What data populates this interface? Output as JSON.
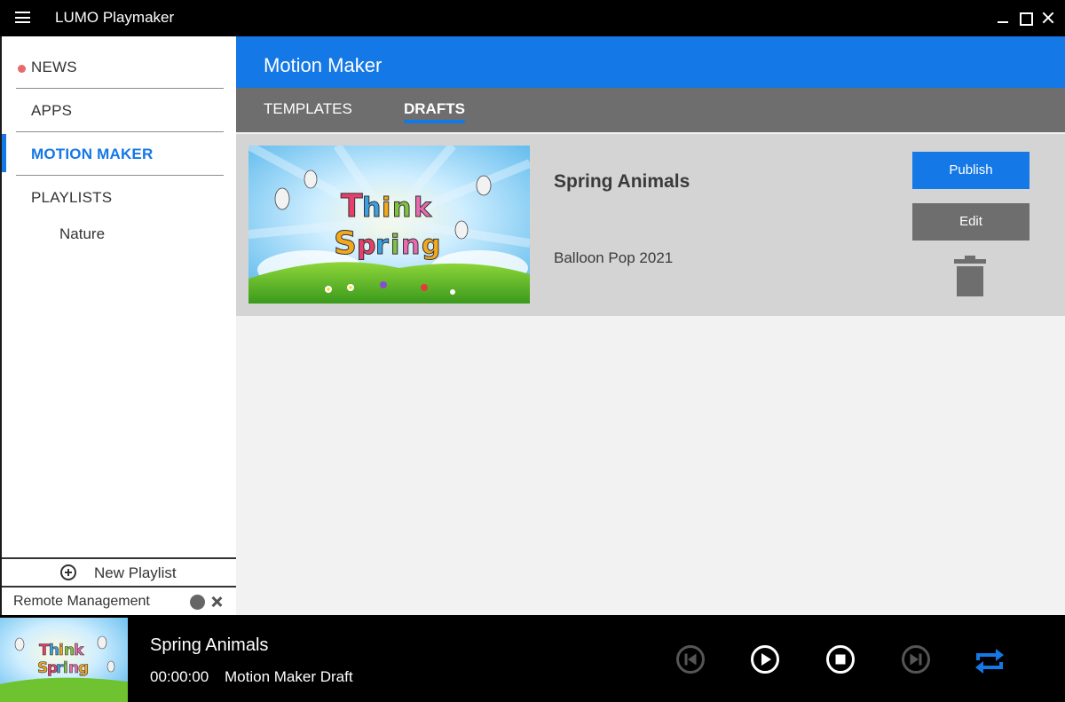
{
  "window": {
    "title": "LUMO Playmaker"
  },
  "sidebar": {
    "items": [
      {
        "label": "NEWS",
        "badge_color": "#e86a6a"
      },
      {
        "label": "APPS"
      },
      {
        "label": "MOTION MAKER",
        "active": true
      },
      {
        "label": "PLAYLISTS"
      }
    ],
    "playlists": [
      {
        "label": "Nature"
      }
    ],
    "new_playlist_label": "New Playlist",
    "remote_management_label": "Remote Management",
    "remote_management_enabled": false
  },
  "main": {
    "title": "Motion Maker",
    "tabs": [
      {
        "label": "TEMPLATES",
        "active": false
      },
      {
        "label": "DRAFTS",
        "active": true
      }
    ],
    "drafts": [
      {
        "title": "Spring Animals",
        "subtitle": "Balloon Pop 2021",
        "thumbnail_text_line1": "Think",
        "thumbnail_text_line2": "Spring",
        "publish_label": "Publish",
        "edit_label": "Edit"
      }
    ]
  },
  "player": {
    "title": "Spring Animals",
    "time": "00:00:00",
    "source": "Motion Maker Draft",
    "thumbnail_text_line1": "Think",
    "thumbnail_text_line2": "Spring",
    "controls": [
      "skip-previous-icon",
      "play-icon",
      "stop-icon",
      "skip-next-icon",
      "repeat-icon"
    ],
    "repeat_color": "#1478e6"
  },
  "colors": {
    "accent": "#1478e6",
    "tab_bar": "#6e6e6e",
    "card_bg": "#d4d4d4"
  }
}
